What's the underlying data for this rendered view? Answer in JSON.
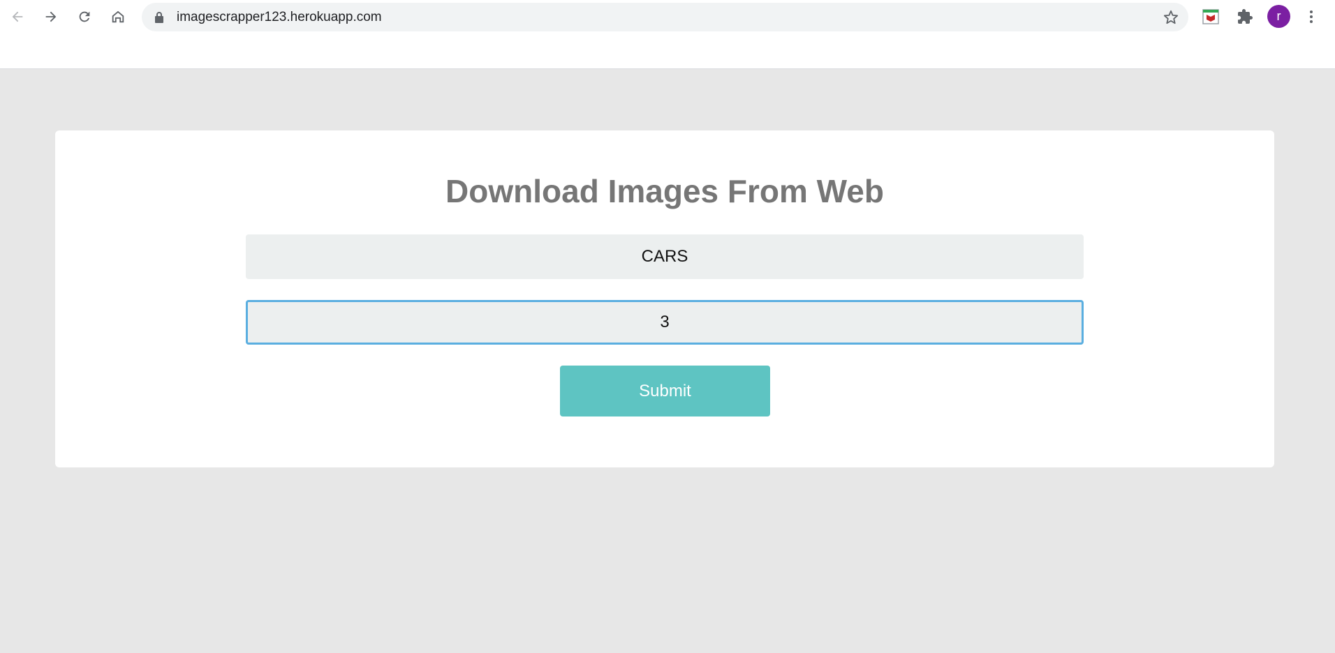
{
  "browser": {
    "url": "imagescrapper123.herokuapp.com",
    "profile_initial": "r"
  },
  "page": {
    "title": "Download Images From Web",
    "search_value": "CARS",
    "count_value": "3",
    "submit_label": "Submit"
  },
  "icons": {
    "back": "back-arrow-icon",
    "forward": "forward-arrow-icon",
    "reload": "reload-icon",
    "home": "home-icon",
    "lock": "lock-icon",
    "bookmark": "star-icon",
    "extension": "mcafee-extension-icon",
    "extensions_menu": "puzzle-icon",
    "menu": "kebab-menu-icon"
  },
  "colors": {
    "page_background": "#e7e7e7",
    "card_background": "#ffffff",
    "title": "#767676",
    "input_background": "#ecefef",
    "focus_border": "#5aaee0",
    "button": "#5ec4c2",
    "avatar": "#7b1fa2"
  }
}
